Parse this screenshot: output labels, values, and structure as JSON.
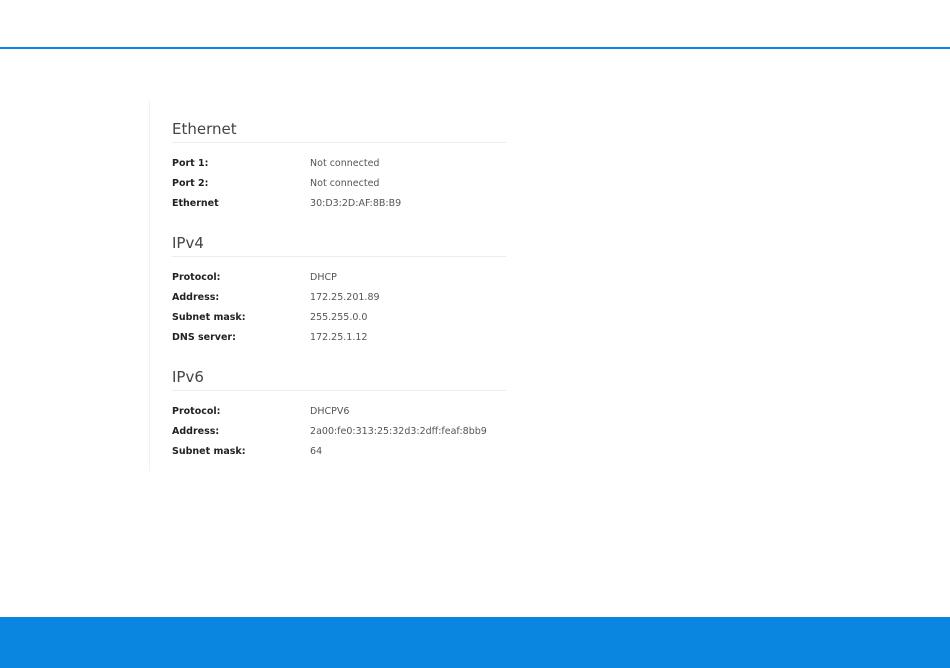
{
  "colors": {
    "accent": "#0a86e0"
  },
  "sections": [
    {
      "title": "Ethernet",
      "rows": [
        {
          "label": "Port 1:",
          "value": "Not connected"
        },
        {
          "label": "Port 2:",
          "value": "Not connected"
        },
        {
          "label": "Ethernet",
          "value": "30:D3:2D:AF:8B:B9"
        }
      ]
    },
    {
      "title": "IPv4",
      "rows": [
        {
          "label": "Protocol:",
          "value": "DHCP"
        },
        {
          "label": "Address:",
          "value": "172.25.201.89"
        },
        {
          "label": "Subnet mask:",
          "value": "255.255.0.0"
        },
        {
          "label": "DNS server:",
          "value": "172.25.1.12"
        }
      ]
    },
    {
      "title": "IPv6",
      "rows": [
        {
          "label": "Protocol:",
          "value": "DHCPV6"
        },
        {
          "label": "Address:",
          "value": "2a00:fe0:313:25:32d3:2dff:feaf:8bb9"
        },
        {
          "label": "Subnet mask:",
          "value": "64"
        }
      ]
    }
  ]
}
